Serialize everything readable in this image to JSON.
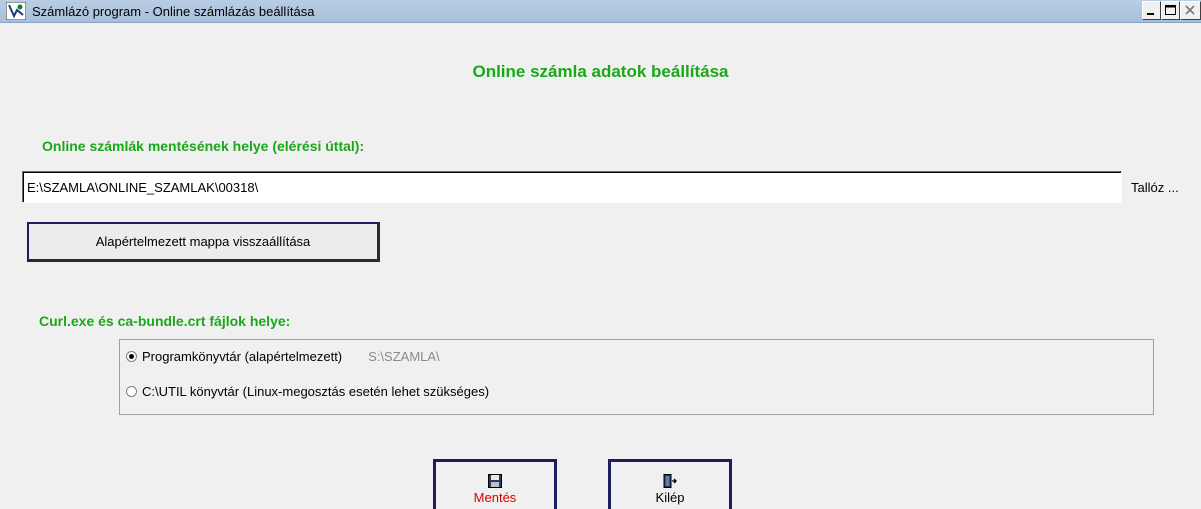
{
  "window": {
    "title": "Számlázó program  -  Online számlázás beállítása",
    "minimize_label": "minimize",
    "maximize_label": "maximize",
    "close_label": "close"
  },
  "main": {
    "heading": "Online számla adatok beállítása",
    "save_path_label": "Online számlák mentésének helye (elérési úttal):",
    "save_path_value": "E:\\SZAMLA\\ONLINE_SZAMLAK\\00318\\",
    "browse_button": "Tallóz ...",
    "reset_folder_button": "Alapértelmezett mappa visszaállítása",
    "curl_location_label": "Curl.exe és ca-bundle.crt fájlok helye:",
    "options": [
      {
        "label": "Programkönyvtár (alapértelmezett)",
        "path": "S:\\SZAMLA\\",
        "selected": true
      },
      {
        "label": "C:\\UTIL könyvtár (Linux-megosztás esetén lehet szükséges)",
        "selected": false
      }
    ]
  },
  "footer": {
    "save_button": "Mentés",
    "exit_button": "Kilép",
    "save_color": "#e00000"
  },
  "colors": {
    "accent_green": "#1aa81a",
    "titlebar": "#aec4de"
  }
}
